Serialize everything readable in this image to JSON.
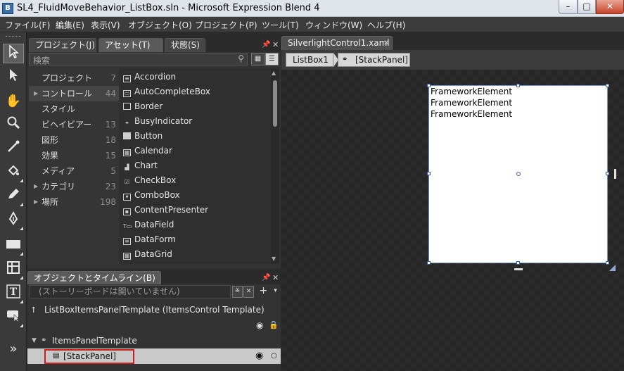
{
  "window": {
    "title": "SL4_FluidMoveBehavior_ListBox.sln - Microsoft Expression Blend 4",
    "minimize": "–",
    "maximize": "□",
    "close": "✕"
  },
  "menu": [
    "ファイル(F)",
    "編集(E)",
    "表示(V)",
    "オブジェクト(O)",
    "プロジェクト(P)",
    "ツール(T)",
    "ウィンドウ(W)",
    "ヘルプ(H)"
  ],
  "assets_panel": {
    "tabs": [
      "プロジェクト(J)",
      "アセット(T)",
      "状態(S)"
    ],
    "active_tab": "アセット(T)",
    "search_placeholder": "検索",
    "categories": [
      {
        "label": "プロジェクト",
        "count": "7",
        "expandable": false
      },
      {
        "label": "コントロール",
        "count": "44",
        "expandable": true
      },
      {
        "label": "スタイル",
        "count": "",
        "expandable": false
      },
      {
        "label": "ビヘイビアー",
        "count": "13",
        "expandable": false
      },
      {
        "label": "図形",
        "count": "18",
        "expandable": false
      },
      {
        "label": "効果",
        "count": "15",
        "expandable": false
      },
      {
        "label": "メディア",
        "count": "5",
        "expandable": false
      },
      {
        "label": "カテゴリ",
        "count": "23",
        "expandable": true
      },
      {
        "label": "場所",
        "count": "198",
        "expandable": true
      }
    ],
    "assets": [
      {
        "label": "Accordion",
        "icon": "accordion-icon"
      },
      {
        "label": "AutoCompleteBox",
        "icon": "autocomplete-icon"
      },
      {
        "label": "Border",
        "icon": "border-icon"
      },
      {
        "label": "BusyIndicator",
        "icon": "busy-indicator-icon"
      },
      {
        "label": "Button",
        "icon": "button-icon"
      },
      {
        "label": "Calendar",
        "icon": "calendar-icon"
      },
      {
        "label": "Chart",
        "icon": "chart-icon"
      },
      {
        "label": "CheckBox",
        "icon": "checkbox-icon"
      },
      {
        "label": "ComboBox",
        "icon": "combobox-icon"
      },
      {
        "label": "ContentPresenter",
        "icon": "content-presenter-icon"
      },
      {
        "label": "DataField",
        "icon": "datafield-icon"
      },
      {
        "label": "DataForm",
        "icon": "dataform-icon"
      },
      {
        "label": "DataGrid",
        "icon": "datagrid-icon"
      }
    ]
  },
  "objects_panel": {
    "title": "オブジェクトとタイムライン(B)",
    "storyboard": "(ストーリーボードは開いていません)",
    "template_root": "ListBoxItemsPanelTemplate (ItemsControl Template)",
    "items_panel": "ItemsPanelTemplate",
    "selected_item": "[StackPanel]"
  },
  "document": {
    "tab": "SilverlightControl1.xaml",
    "breadcrumb": [
      "ListBox1",
      "[StackPanel]"
    ],
    "elements": [
      "FrameworkElement",
      "FrameworkElement",
      "FrameworkElement"
    ]
  }
}
